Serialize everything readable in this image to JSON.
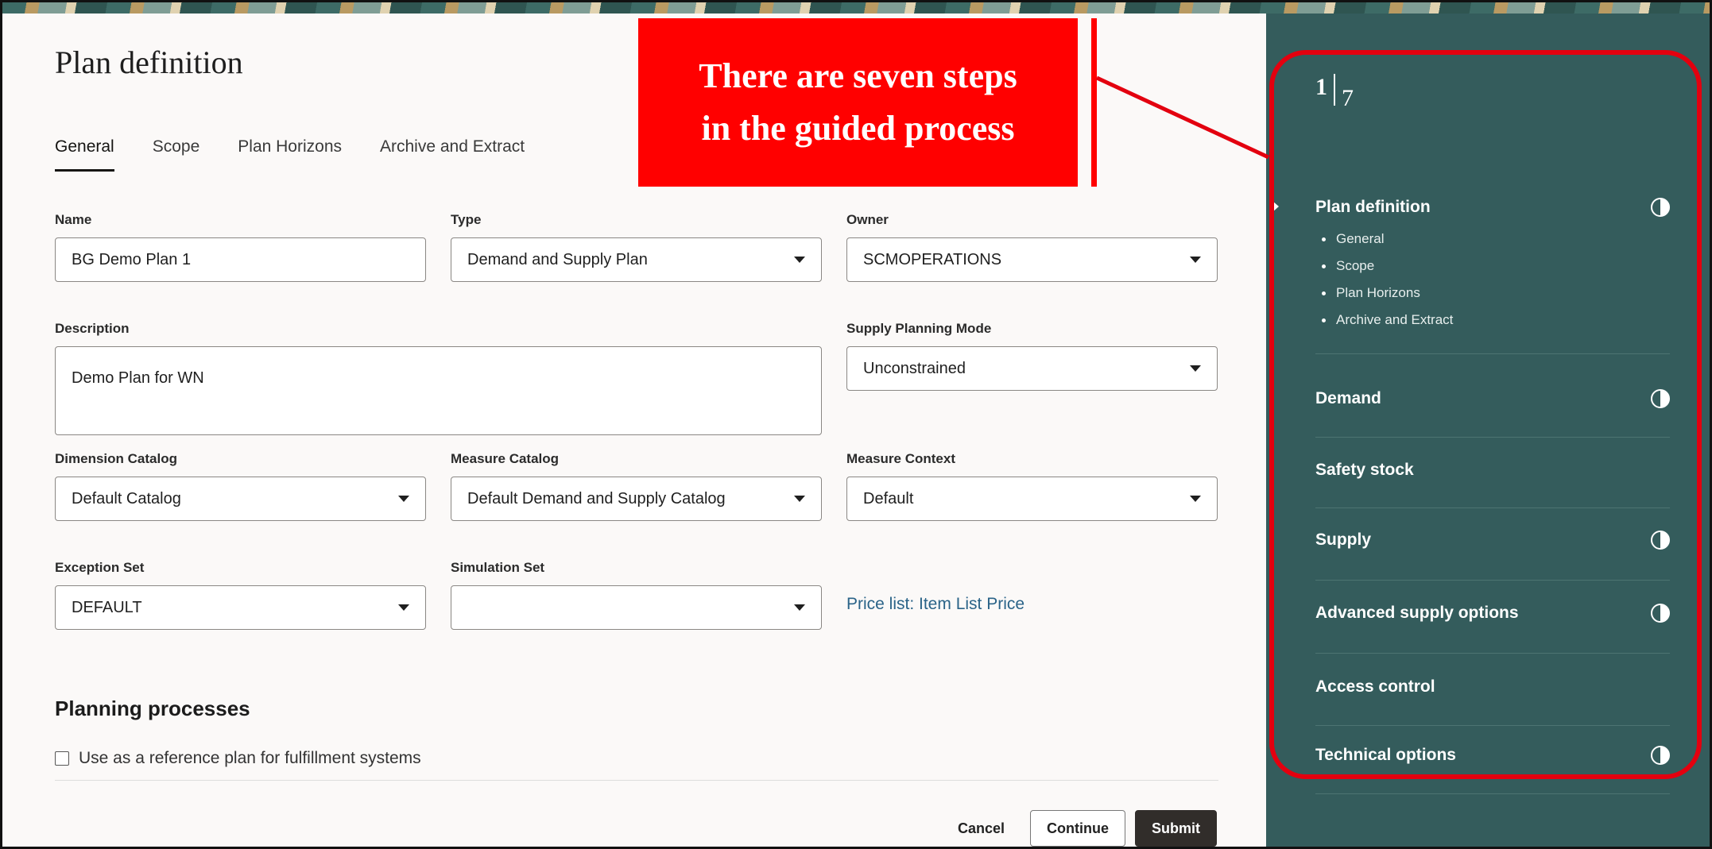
{
  "page": {
    "title": "Plan definition"
  },
  "tabs": [
    {
      "label": "General",
      "active": true
    },
    {
      "label": "Scope",
      "active": false
    },
    {
      "label": "Plan Horizons",
      "active": false
    },
    {
      "label": "Archive and Extract",
      "active": false
    }
  ],
  "form": {
    "name": {
      "label": "Name",
      "value": "BG Demo Plan 1"
    },
    "type": {
      "label": "Type",
      "value": "Demand and Supply Plan"
    },
    "owner": {
      "label": "Owner",
      "value": "SCMOPERATIONS"
    },
    "description": {
      "label": "Description",
      "value": "Demo Plan for WN"
    },
    "supply_planning_mode": {
      "label": "Supply Planning Mode",
      "value": "Unconstrained"
    },
    "dimension_catalog": {
      "label": "Dimension Catalog",
      "value": "Default Catalog"
    },
    "measure_catalog": {
      "label": "Measure Catalog",
      "value": "Default Demand and Supply Catalog"
    },
    "measure_context": {
      "label": "Measure Context",
      "value": "Default"
    },
    "exception_set": {
      "label": "Exception Set",
      "value": "DEFAULT"
    },
    "simulation_set": {
      "label": "Simulation Set",
      "value": ""
    },
    "price_list_link": "Price list: Item List Price"
  },
  "planning_processes": {
    "heading": "Planning processes",
    "reference_plan_label": "Use as a reference plan for fulfillment systems",
    "reference_plan_checked": false
  },
  "actions": {
    "cancel": "Cancel",
    "continue": "Continue",
    "submit": "Submit"
  },
  "sidebar": {
    "current_step": "1",
    "total_steps": "7",
    "steps": [
      {
        "name": "Plan definition",
        "status_icon": "half-circle-icon",
        "sub_items": [
          "General",
          "Scope",
          "Plan Horizons",
          "Archive and Extract"
        ]
      },
      {
        "name": "Demand",
        "status_icon": "half-circle-icon"
      },
      {
        "name": "Safety stock",
        "status_icon": ""
      },
      {
        "name": "Supply",
        "status_icon": "half-circle-icon"
      },
      {
        "name": "Advanced supply options",
        "status_icon": "half-circle-icon"
      },
      {
        "name": "Access control",
        "status_icon": ""
      },
      {
        "name": "Technical options",
        "status_icon": "half-circle-icon"
      }
    ]
  },
  "callout": {
    "line1": "There are seven steps",
    "line2": "in the guided process",
    "color": "#ff0000"
  },
  "colors": {
    "sidebar_bg": "#345c5c",
    "primary_button": "#312d2a",
    "link": "#2a6388",
    "annotation": "#e3000f"
  }
}
